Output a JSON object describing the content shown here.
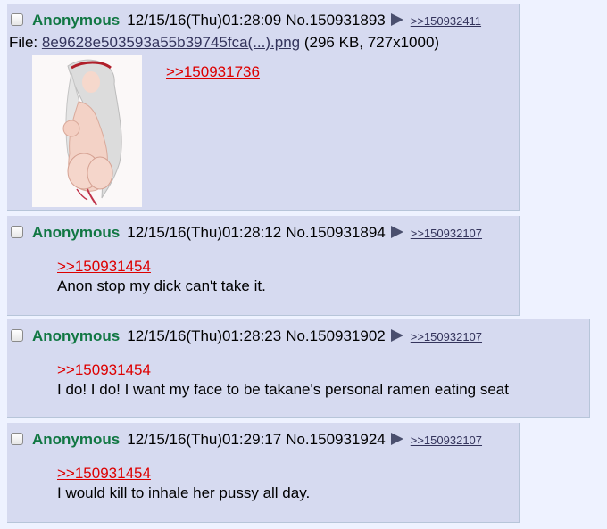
{
  "posts": [
    {
      "name": "Anonymous",
      "datetime": "12/15/16(Thu)01:28:09",
      "number": "No.150931893",
      "backlink": ">>150932411",
      "file": {
        "prefix": "File:",
        "filename": "8e9628e503593a55b39745fca(...).png",
        "meta": "(296 KB, 727x1000)"
      },
      "quote": ">>150931736",
      "text": ""
    },
    {
      "name": "Anonymous",
      "datetime": "12/15/16(Thu)01:28:12",
      "number": "No.150931894",
      "backlink": ">>150932107",
      "quote": ">>150931454",
      "text": "Anon stop my dick can't take it."
    },
    {
      "name": "Anonymous",
      "datetime": "12/15/16(Thu)01:28:23",
      "number": "No.150931902",
      "backlink": ">>150932107",
      "quote": ">>150931454",
      "text": "I do! I do! I want my face to be takane's personal ramen eating seat"
    },
    {
      "name": "Anonymous",
      "datetime": "12/15/16(Thu)01:29:17",
      "number": "No.150931924",
      "backlink": ">>150932107",
      "quote": ">>150931454",
      "text": "I would kill to inhale her pussy all day."
    }
  ],
  "colors": {
    "page_bg": "#eef2ff",
    "post_bg": "#d6daf0",
    "name": "#117743",
    "quotelink": "#dd0000",
    "link": "#34345c"
  },
  "icons": {
    "checkbox": "checkbox-icon",
    "backlink_arrow": "triangle-right-icon",
    "thumbnail": "image-thumbnail"
  }
}
